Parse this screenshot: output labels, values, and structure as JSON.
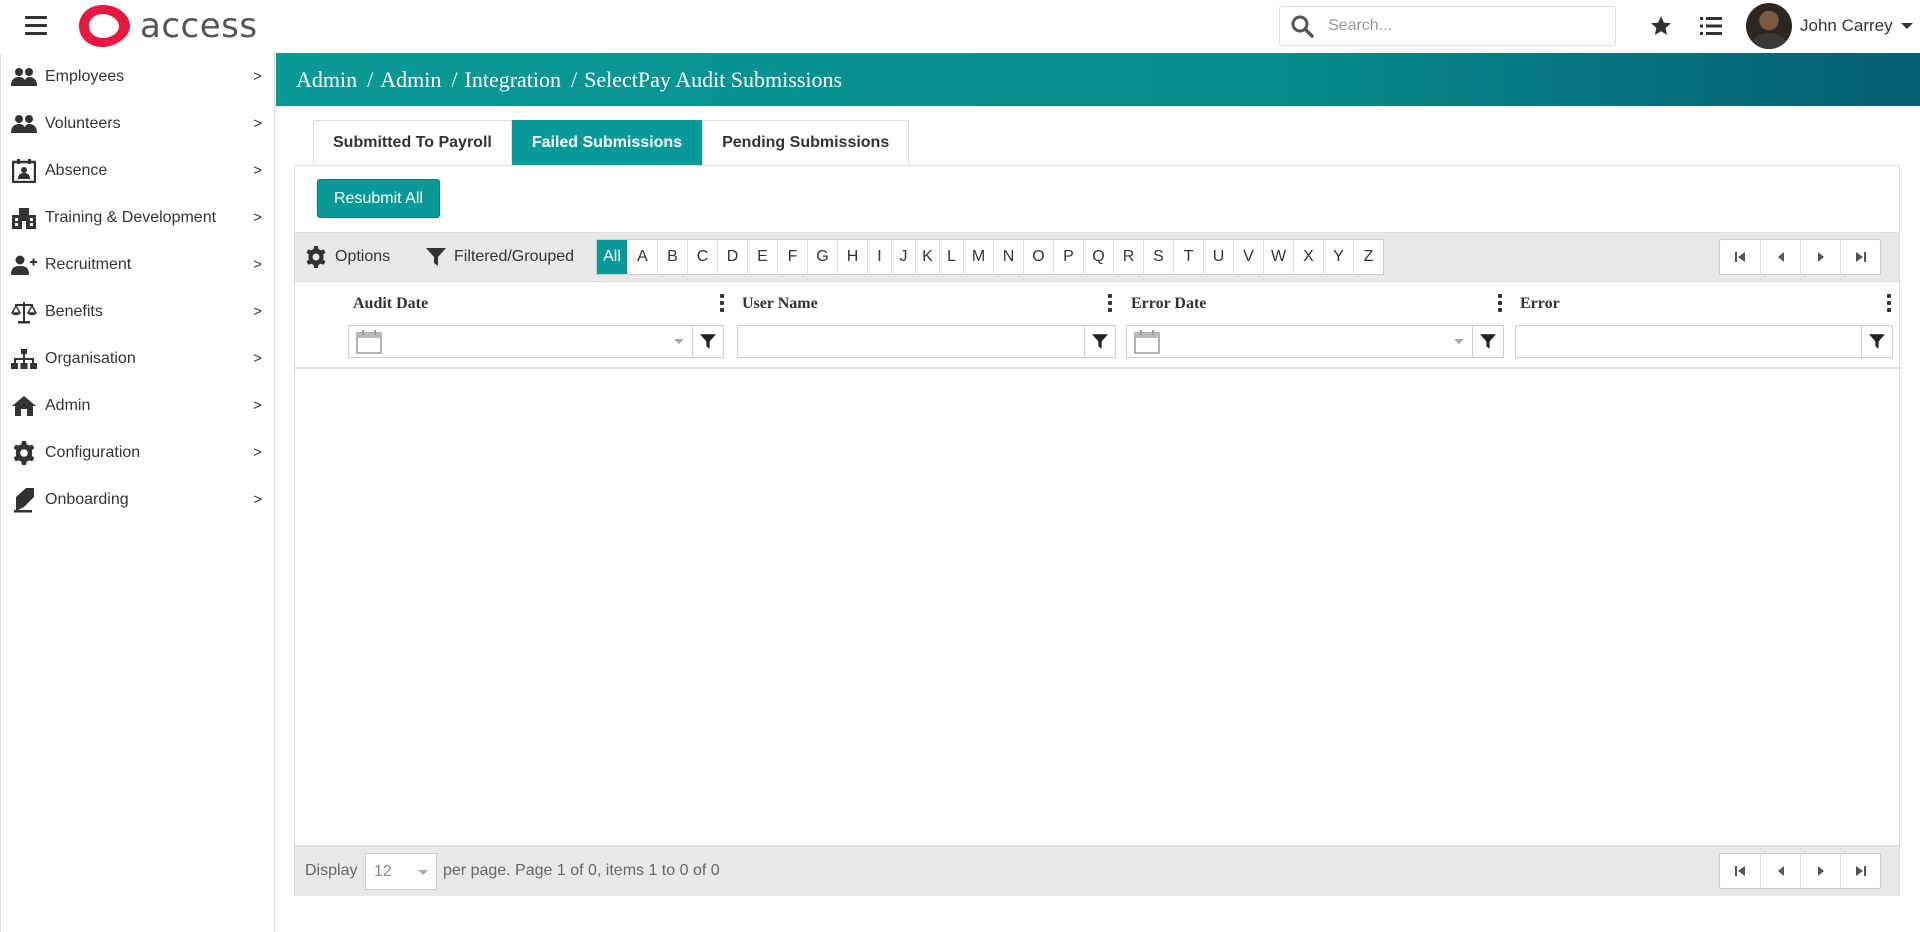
{
  "app": {
    "logo_text": "access",
    "brand_color": "#079a98",
    "logo_color": "#e5193f"
  },
  "search": {
    "placeholder": "Search..."
  },
  "user": {
    "name": "John Carrey"
  },
  "sidebar": {
    "items": [
      {
        "label": "Employees",
        "icon": "users-icon"
      },
      {
        "label": "Volunteers",
        "icon": "users-icon"
      },
      {
        "label": "Absence",
        "icon": "calendar-person-icon"
      },
      {
        "label": "Training & Development",
        "icon": "school-icon"
      },
      {
        "label": "Recruitment",
        "icon": "user-plus-icon"
      },
      {
        "label": "Benefits",
        "icon": "scales-icon"
      },
      {
        "label": "Organisation",
        "icon": "sitemap-icon"
      },
      {
        "label": "Admin",
        "icon": "home-icon"
      },
      {
        "label": "Configuration",
        "icon": "gear-icon"
      },
      {
        "label": "Onboarding",
        "icon": "document-pen-icon"
      }
    ]
  },
  "breadcrumb": [
    "Admin",
    "Admin",
    "Integration",
    "SelectPay Audit Submissions"
  ],
  "tabs": [
    {
      "label": "Submitted To Payroll",
      "active": false
    },
    {
      "label": "Failed Submissions",
      "active": true
    },
    {
      "label": "Pending Submissions",
      "active": false
    }
  ],
  "actions": {
    "resubmit_label": "Resubmit All"
  },
  "toolbar": {
    "options_label": "Options",
    "filtered_label": "Filtered/Grouped",
    "letters": [
      "All",
      "A",
      "B",
      "C",
      "D",
      "E",
      "F",
      "G",
      "H",
      "I",
      "J",
      "K",
      "L",
      "M",
      "N",
      "O",
      "P",
      "Q",
      "R",
      "S",
      "T",
      "U",
      "V",
      "W",
      "X",
      "Y",
      "Z"
    ],
    "active_letter": "All"
  },
  "grid": {
    "columns": [
      {
        "title": "Audit Date",
        "filter_type": "date"
      },
      {
        "title": "User Name",
        "filter_type": "text"
      },
      {
        "title": "Error Date",
        "filter_type": "date"
      },
      {
        "title": "Error",
        "filter_type": "text"
      }
    ],
    "rows": []
  },
  "footer": {
    "display_label": "Display",
    "per_page_value": "12",
    "status_text": "per page. Page 1 of 0, items 1 to 0 of 0"
  }
}
